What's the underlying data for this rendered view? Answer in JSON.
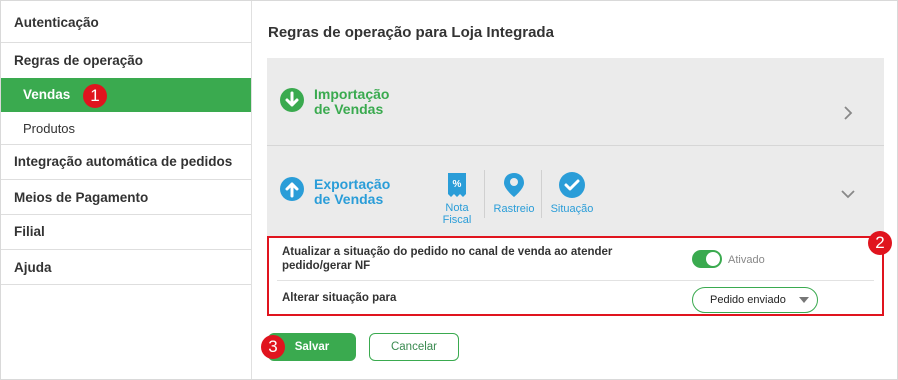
{
  "sidebar": {
    "items": [
      {
        "label": "Autenticação"
      },
      {
        "label": "Regras de operação"
      },
      {
        "label": "Vendas"
      },
      {
        "label": "Produtos"
      },
      {
        "label": "Integração automática de pedidos"
      },
      {
        "label": "Meios de Pagamento"
      },
      {
        "label": "Filial"
      },
      {
        "label": "Ajuda"
      }
    ]
  },
  "badges": {
    "one": "1",
    "two": "2",
    "three": "3"
  },
  "main": {
    "title": "Regras de operação para Loja Integrada",
    "import_panel": {
      "title_line1": "Importação",
      "title_line2": "de Vendas"
    },
    "export_panel": {
      "title_line1": "Exportação",
      "title_line2": "de Vendas",
      "subtabs": [
        {
          "label_line1": "Nota",
          "label_line2": "Fiscal",
          "icon": "invoice-icon"
        },
        {
          "label": "Rastreio",
          "icon": "location-pin-icon"
        },
        {
          "label": "Situação",
          "icon": "check-circle-icon"
        }
      ]
    },
    "rules": {
      "row1_label": "Atualizar a situação do pedido no canal de venda ao atender pedido/gerar NF",
      "toggle_state": "Ativado",
      "row2_label": "Alterar situação para",
      "select_value": "Pedido enviado"
    },
    "buttons": {
      "save": "Salvar",
      "cancel": "Cancelar"
    }
  },
  "colors": {
    "accent": "#3aaa4f",
    "highlight": "#e0141e",
    "export_blue": "#2a9dd8"
  }
}
